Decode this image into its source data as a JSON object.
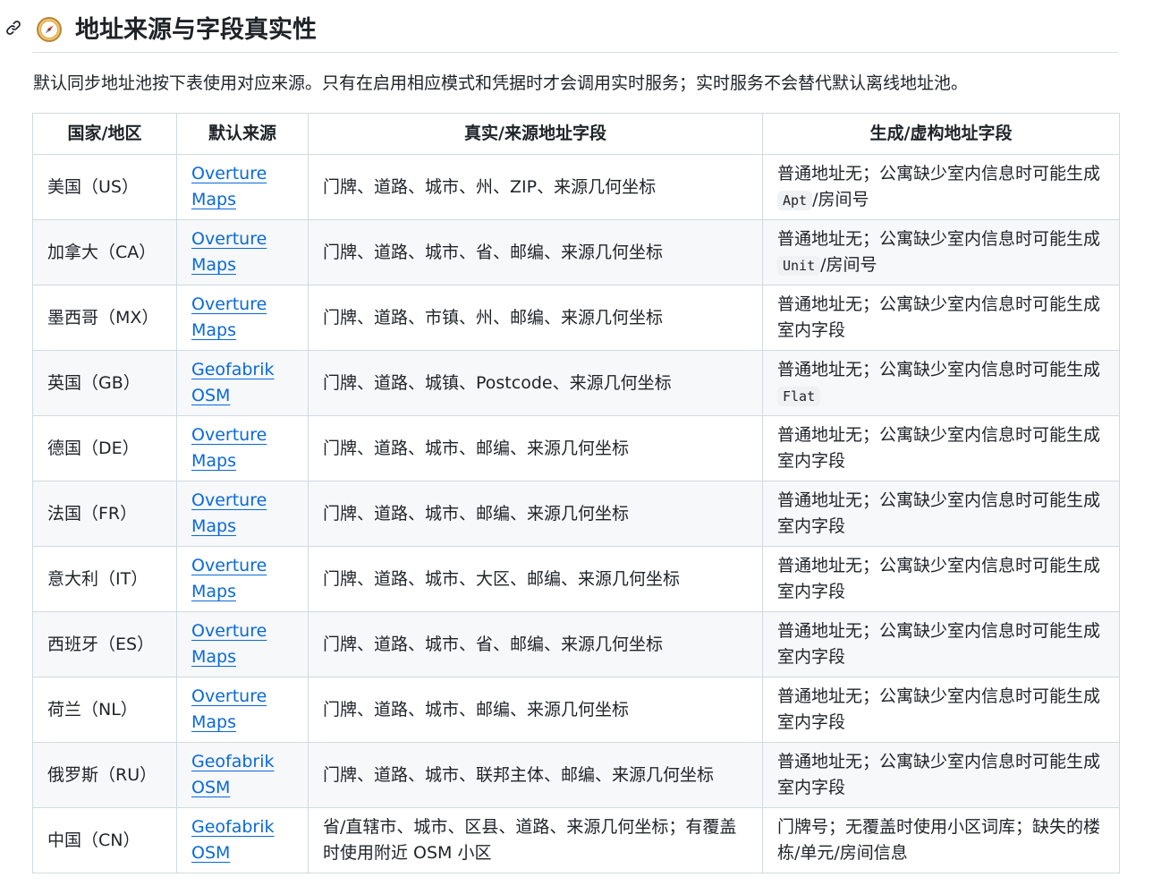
{
  "heading": {
    "title": "地址来源与字段真实性",
    "anchor_icon": "link-icon",
    "emoji_icon": "compass-icon"
  },
  "intro": "默认同步地址池按下表使用对应来源。只有在启用相应模式和凭据时才会调用实时服务；实时服务不会替代默认离线地址池。",
  "table": {
    "headers": [
      "国家/地区",
      "默认来源",
      "真实/来源地址字段",
      "生成/虚构地址字段"
    ],
    "rows": [
      {
        "country": "美国（US）",
        "source1": "Overture",
        "source2": "Maps",
        "real": "门牌、道路、城市、州、ZIP、来源几何坐标",
        "gen1": "普通地址无；公寓缺少室内信息时可能生成",
        "code": "Apt",
        "gen2": "/房间号"
      },
      {
        "country": "加拿大（CA）",
        "source1": "Overture",
        "source2": "Maps",
        "real": "门牌、道路、城市、省、邮编、来源几何坐标",
        "gen1": "普通地址无；公寓缺少室内信息时可能生成",
        "code": "Unit",
        "gen2": "/房间号"
      },
      {
        "country": "墨西哥（MX）",
        "source1": "Overture",
        "source2": "Maps",
        "real": "门牌、道路、市镇、州、邮编、来源几何坐标",
        "gen1": "普通地址无；公寓缺少室内信息时可能生成",
        "code": "",
        "gen2": "室内字段"
      },
      {
        "country": "英国（GB）",
        "source1": "Geofabrik",
        "source2": "OSM",
        "real": "门牌、道路、城镇、Postcode、来源几何坐标",
        "gen1": "普通地址无；公寓缺少室内信息时可能生成",
        "code": "Flat",
        "gen2": ""
      },
      {
        "country": "德国（DE）",
        "source1": "Overture",
        "source2": "Maps",
        "real": "门牌、道路、城市、邮编、来源几何坐标",
        "gen1": "普通地址无；公寓缺少室内信息时可能生成",
        "code": "",
        "gen2": "室内字段"
      },
      {
        "country": "法国（FR）",
        "source1": "Overture",
        "source2": "Maps",
        "real": "门牌、道路、城市、邮编、来源几何坐标",
        "gen1": "普通地址无；公寓缺少室内信息时可能生成",
        "code": "",
        "gen2": "室内字段"
      },
      {
        "country": "意大利（IT）",
        "source1": "Overture",
        "source2": "Maps",
        "real": "门牌、道路、城市、大区、邮编、来源几何坐标",
        "gen1": "普通地址无；公寓缺少室内信息时可能生成",
        "code": "",
        "gen2": "室内字段"
      },
      {
        "country": "西班牙（ES）",
        "source1": "Overture",
        "source2": "Maps",
        "real": "门牌、道路、城市、省、邮编、来源几何坐标",
        "gen1": "普通地址无；公寓缺少室内信息时可能生成",
        "code": "",
        "gen2": "室内字段"
      },
      {
        "country": "荷兰（NL）",
        "source1": "Overture",
        "source2": "Maps",
        "real": "门牌、道路、城市、邮编、来源几何坐标",
        "gen1": "普通地址无；公寓缺少室内信息时可能生成",
        "code": "",
        "gen2": "室内字段"
      },
      {
        "country": "俄罗斯（RU）",
        "source1": "Geofabrik",
        "source2": "OSM",
        "real": "门牌、道路、城市、联邦主体、邮编、来源几何坐标",
        "gen1": "普通地址无；公寓缺少室内信息时可能生成",
        "code": "",
        "gen2": "室内字段"
      },
      {
        "country": "中国（CN）",
        "source1": "Geofabrik",
        "source2": "OSM",
        "real": "省/直辖市、城市、区县、道路、来源几何坐标；有覆盖时使用附近 OSM 小区",
        "gen1": "门牌号；无覆盖时使用小区词库；缺失的楼栋/单元/房间信息",
        "code": "",
        "gen2": ""
      }
    ]
  }
}
